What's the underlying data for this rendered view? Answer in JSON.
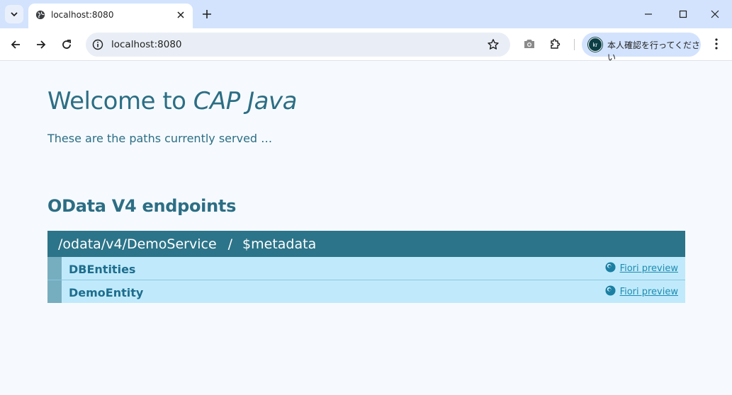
{
  "browser": {
    "tab_title": "localhost:8080",
    "url": "localhost:8080",
    "profile_label": "本人確認を行ってください",
    "avatar_initials": "kr"
  },
  "page": {
    "welcome_prefix": "Welcome to ",
    "welcome_em": "CAP Java",
    "subtitle": "These are the paths currently served …",
    "section_title": "OData V4 endpoints",
    "service": {
      "path": "/odata/v4/DemoService",
      "separator": "/",
      "metadata": "$metadata"
    },
    "entities": [
      {
        "name": "DBEntities",
        "preview": "Fiori preview"
      },
      {
        "name": "DemoEntity",
        "preview": "Fiori preview"
      }
    ]
  },
  "colors": {
    "accent": "#2c6e84",
    "header_bg": "#2c7489",
    "row_bg": "#c0eafc",
    "row_bar": "#76aec0"
  }
}
